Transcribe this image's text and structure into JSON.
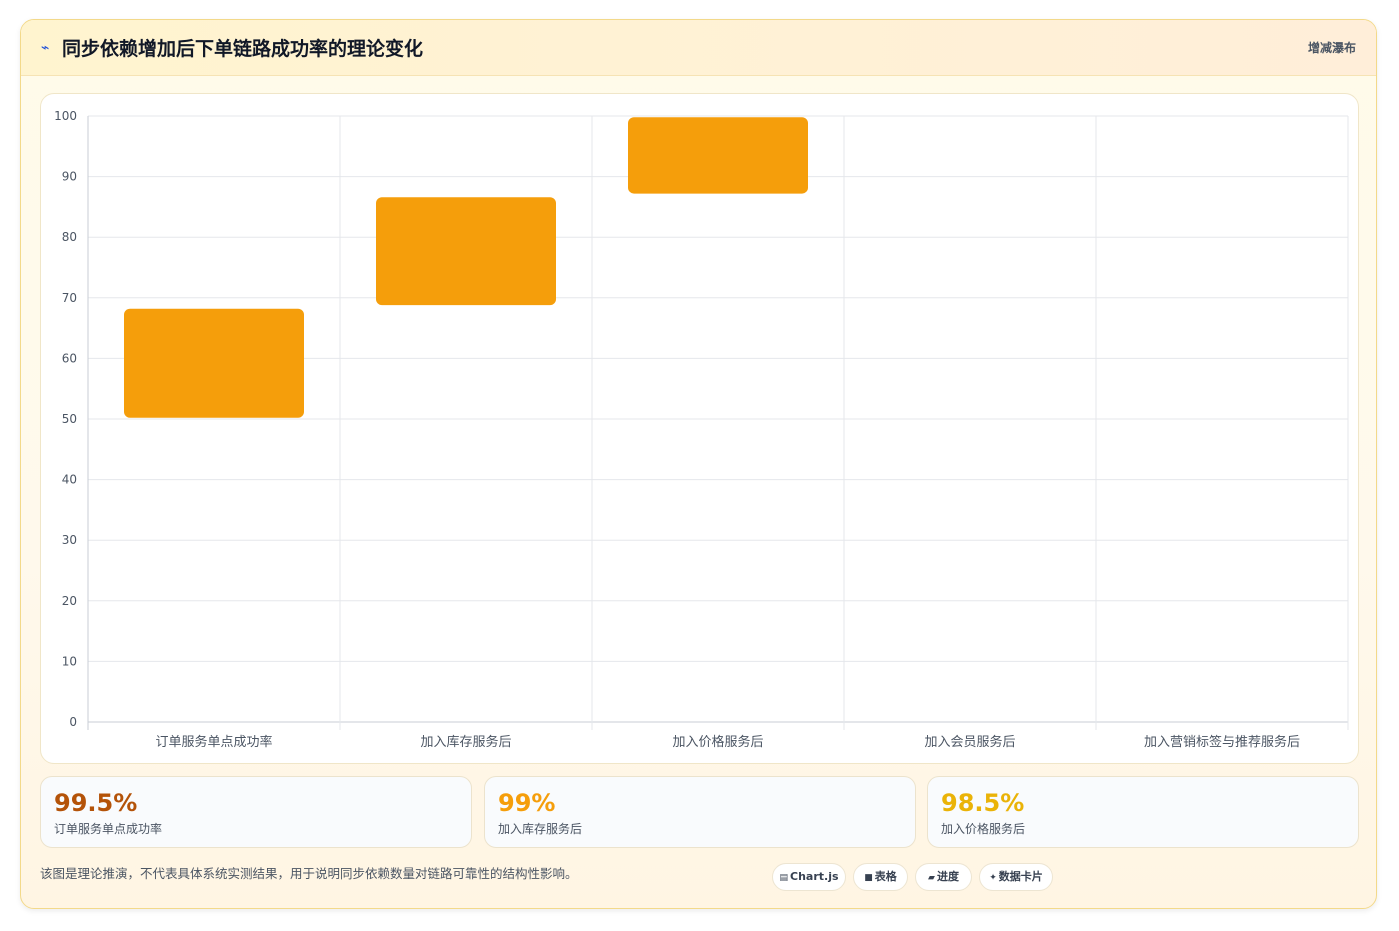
{
  "header": {
    "icon": "trend-icon",
    "icon_glyph": "⌁",
    "title": "同步依赖增加后下单链路成功率的理论变化",
    "tag": "增减瀑布"
  },
  "chart_data": {
    "type": "bar",
    "subtype": "waterfall",
    "categories": [
      "订单服务单点成功率",
      "加入库存服务后",
      "加入价格服务后",
      "加入会员服务后",
      "加入营销标签与推荐服务后"
    ],
    "series": [
      {
        "ranges": [
          [
            50.2,
            68.2
          ],
          [
            68.8,
            86.6
          ],
          [
            87.2,
            99.8
          ],
          null,
          null
        ],
        "color": "#f59e0b"
      }
    ],
    "ylim": [
      0,
      100
    ],
    "yticks": [
      0,
      10,
      20,
      30,
      40,
      50,
      60,
      70,
      80,
      90,
      100
    ],
    "grid": true,
    "legend": "none"
  },
  "stats": [
    {
      "value": "99.5%",
      "label": "订单服务单点成功率",
      "color": "#b45309"
    },
    {
      "value": "99%",
      "label": "加入库存服务后",
      "color": "#f59e0b"
    },
    {
      "value": "98.5%",
      "label": "加入价格服务后",
      "color": "#eab308"
    }
  ],
  "footnote": "该图是理论推演，不代表具体系统实测结果，用于说明同步依赖数量对链路可靠性的结构性影响。",
  "pills": [
    {
      "icon": "chart-icon",
      "glyph": "▤",
      "label": "Chart.js"
    },
    {
      "icon": "table-icon",
      "glyph": "■",
      "label": "表格"
    },
    {
      "icon": "progress-icon",
      "glyph": "▰",
      "label": "进度"
    },
    {
      "icon": "sparkle-icon",
      "glyph": "✦",
      "label": "数据卡片"
    }
  ]
}
